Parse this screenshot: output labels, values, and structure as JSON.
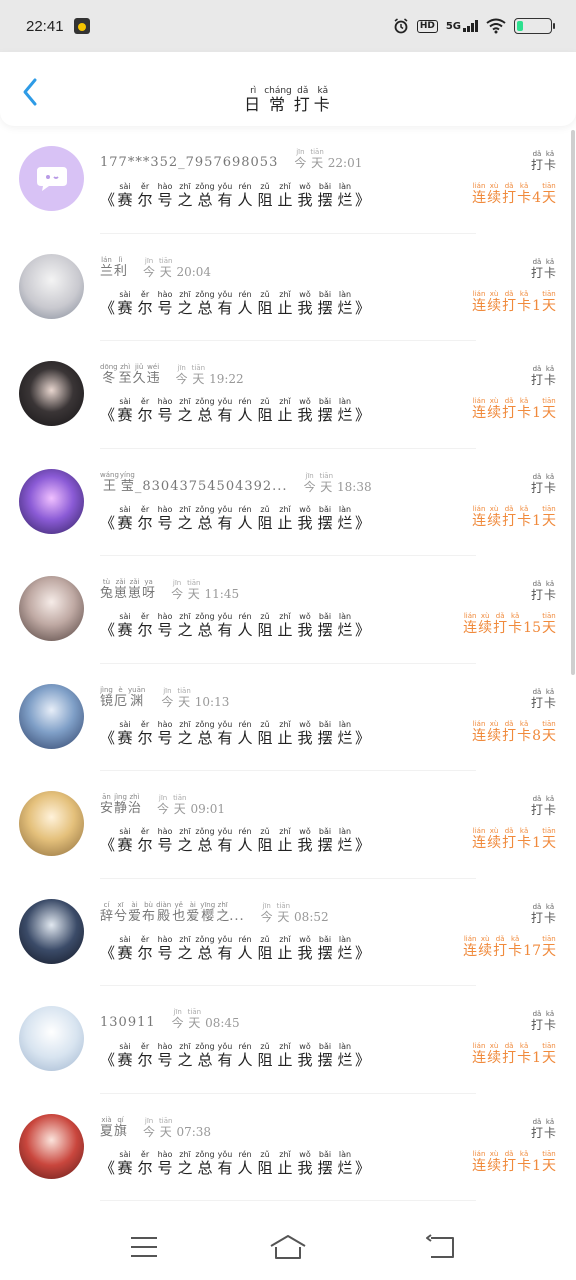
{
  "status_bar": {
    "time": "22:41",
    "icons": [
      "alarm-icon",
      "hd-icon",
      "5g-signal-icon",
      "wifi-icon",
      "battery-icon"
    ],
    "network": "5G",
    "hd": "HD",
    "battery_level": 0.2,
    "battery_color": "#2ee08f"
  },
  "header": {
    "title_chars": [
      {
        "c": "日",
        "p": "rì"
      },
      {
        "c": "常",
        "p": "cháng"
      },
      {
        "c": "打",
        "p": "dǎ"
      },
      {
        "c": "卡",
        "p": "kǎ"
      }
    ],
    "back_icon": "chevron-left-icon",
    "accent": "#2e9be6"
  },
  "content_line": [
    {
      "c": "赛",
      "p": "sài"
    },
    {
      "c": "尔",
      "p": "ěr"
    },
    {
      "c": "号",
      "p": "hào"
    },
    {
      "c": "之",
      "p": "zhī"
    },
    {
      "c": "总",
      "p": "zǒng"
    },
    {
      "c": "有",
      "p": "yǒu"
    },
    {
      "c": "人",
      "p": "rén"
    },
    {
      "c": "阻",
      "p": "zǔ"
    },
    {
      "c": "止",
      "p": "zhǐ"
    },
    {
      "c": "我",
      "p": "wǒ"
    },
    {
      "c": "摆",
      "p": "bǎi"
    },
    {
      "c": "烂",
      "p": "làn"
    }
  ],
  "brackets": {
    "open": "《",
    "close": "》"
  },
  "daka": [
    {
      "c": "打",
      "p": "dǎ"
    },
    {
      "c": "卡",
      "p": "kǎ"
    }
  ],
  "streak_prefix": [
    {
      "c": "连",
      "p": "lián"
    },
    {
      "c": "续",
      "p": "xù"
    },
    {
      "c": "打",
      "p": "dǎ"
    },
    {
      "c": "卡",
      "p": "kǎ"
    }
  ],
  "streak_suffix": {
    "c": "天",
    "p": "tiān"
  },
  "today": [
    {
      "c": "今",
      "p": "jīn"
    },
    {
      "c": "天",
      "p": "tiān"
    }
  ],
  "streak_color": "#f08a3c",
  "items": [
    {
      "name_plain": "177***352_7957698053",
      "name_chars": [],
      "time": "22:01",
      "streak": "4",
      "avatar": "default-chat-avatar-icon"
    },
    {
      "name_plain": "",
      "name_chars": [
        {
          "c": "兰",
          "p": "lán"
        },
        {
          "c": "利",
          "p": "lì"
        }
      ],
      "time": "20:04",
      "streak": "1",
      "avatar": "anime-avatar"
    },
    {
      "name_plain": "",
      "name_chars": [
        {
          "c": "冬",
          "p": "dōng"
        },
        {
          "c": "至",
          "p": "zhì"
        },
        {
          "c": "久",
          "p": "jiǔ"
        },
        {
          "c": "违",
          "p": "wéi"
        }
      ],
      "time": "19:22",
      "streak": "1",
      "avatar": "photo-avatar"
    },
    {
      "name_plain": "_83043754504392...",
      "name_chars": [
        {
          "c": "王",
          "p": "wáng"
        },
        {
          "c": "莹",
          "p": "yíng"
        }
      ],
      "time": "18:38",
      "streak": "1",
      "avatar": "anime-avatar"
    },
    {
      "name_plain": "",
      "name_chars": [
        {
          "c": "兔",
          "p": "tù"
        },
        {
          "c": "崽",
          "p": "zǎi"
        },
        {
          "c": "崽",
          "p": "zǎi"
        },
        {
          "c": "呀",
          "p": "ya"
        }
      ],
      "time": "11:45",
      "streak": "15",
      "avatar": "anime-avatar"
    },
    {
      "name_plain": "",
      "name_chars": [
        {
          "c": "镜",
          "p": "jìng"
        },
        {
          "c": "厄",
          "p": "è"
        },
        {
          "c": "渊",
          "p": "yuān"
        }
      ],
      "time": "10:13",
      "streak": "8",
      "avatar": "anime-avatar"
    },
    {
      "name_plain": "",
      "name_chars": [
        {
          "c": "安",
          "p": "ān"
        },
        {
          "c": "静",
          "p": "jìng"
        },
        {
          "c": "治",
          "p": "zhì"
        }
      ],
      "time": "09:01",
      "streak": "1",
      "avatar": "anime-avatar"
    },
    {
      "name_plain": "...",
      "name_chars": [
        {
          "c": "辞",
          "p": "cí"
        },
        {
          "c": "兮",
          "p": "xī"
        },
        {
          "c": "爱",
          "p": "ài"
        },
        {
          "c": "布",
          "p": "bù"
        },
        {
          "c": "殿",
          "p": "diàn"
        },
        {
          "c": "也",
          "p": "yě"
        },
        {
          "c": "爱",
          "p": "ài"
        },
        {
          "c": "樱",
          "p": "yīng"
        },
        {
          "c": "之",
          "p": "zhī"
        }
      ],
      "time": "08:52",
      "streak": "17",
      "avatar": "anime-avatar"
    },
    {
      "name_plain": "130911",
      "name_chars": [],
      "time": "08:45",
      "streak": "1",
      "avatar": "anime-avatar"
    },
    {
      "name_plain": "",
      "name_chars": [
        {
          "c": "夏",
          "p": "xià"
        },
        {
          "c": "旗",
          "p": "qí"
        }
      ],
      "time": "07:38",
      "streak": "1",
      "avatar": "anime-avatar"
    }
  ],
  "nav": {
    "menu_icon": "menu-icon",
    "home_icon": "home-icon",
    "back_icon": "back-arrow-icon"
  }
}
